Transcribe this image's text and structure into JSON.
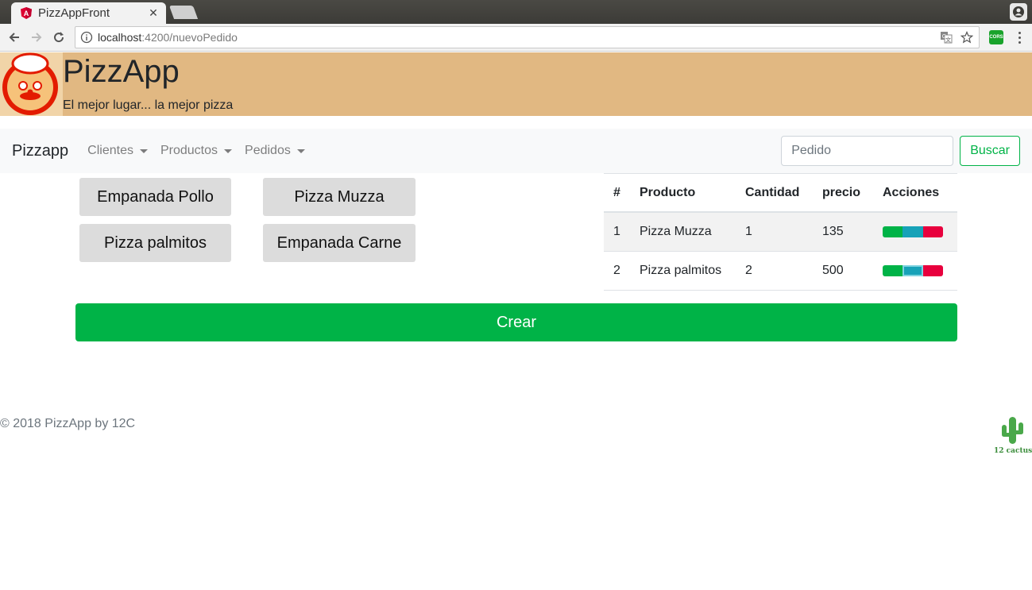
{
  "browser": {
    "tab_title": "PizzAppFront",
    "url_host": "localhost",
    "url_path": ":4200/nuevoPedido",
    "ext_label": "CORS"
  },
  "header": {
    "title": "PizzApp",
    "subtitle": "El mejor lugar... la mejor pizza"
  },
  "navbar": {
    "brand": "Pizzapp",
    "items": [
      {
        "label": "Clientes"
      },
      {
        "label": "Productos"
      },
      {
        "label": "Pedidos"
      }
    ],
    "search_placeholder": "Pedido",
    "search_button": "Buscar"
  },
  "products": [
    {
      "label": "Empanada Pollo"
    },
    {
      "label": "Pizza Muzza"
    },
    {
      "label": "Pizza palmitos"
    },
    {
      "label": "Empanada Carne"
    }
  ],
  "table": {
    "headers": [
      "#",
      "Producto",
      "Cantidad",
      "precio",
      "Acciones"
    ],
    "rows": [
      {
        "num": "1",
        "producto": "Pizza Muzza",
        "cantidad": "1",
        "precio": "135"
      },
      {
        "num": "2",
        "producto": "Pizza palmitos",
        "cantidad": "2",
        "precio": "500"
      }
    ]
  },
  "create_button": "Crear",
  "footer": {
    "text": "© 2018 PizzApp by 12C",
    "logo_text": "12 cactus"
  },
  "colors": {
    "header_bg": "#e1b882",
    "success": "#00b347",
    "info": "#17a2b8",
    "danger": "#e8003d"
  }
}
